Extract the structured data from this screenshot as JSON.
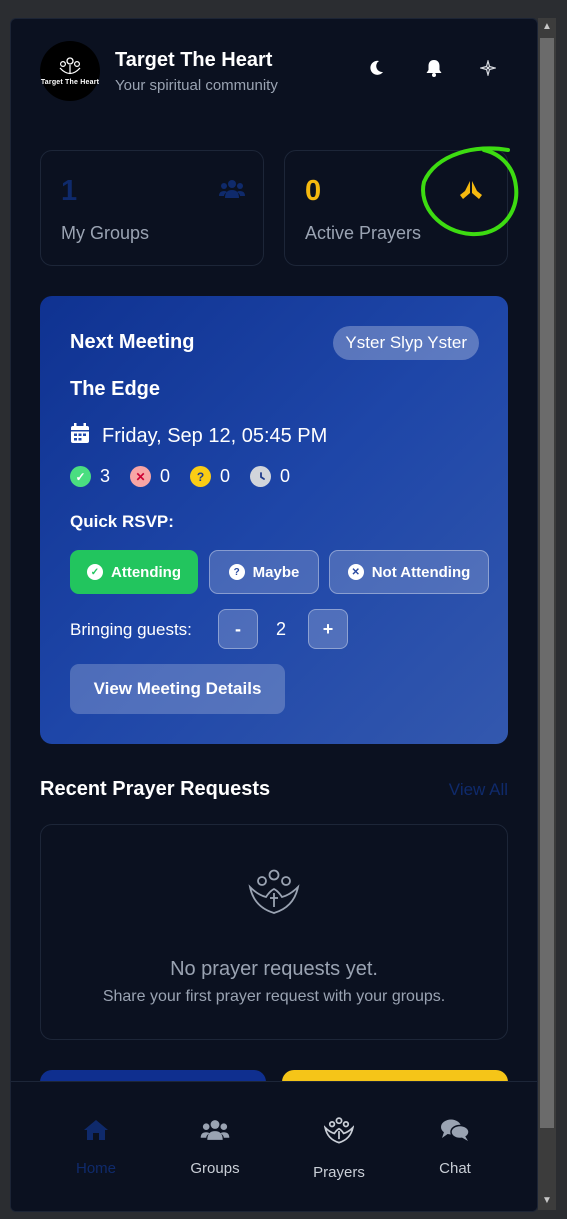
{
  "header": {
    "logo_text": "Target The Heart",
    "title": "Target The Heart",
    "subtitle": "Your spiritual community",
    "icons": [
      "moon-icon",
      "bell-icon",
      "sparkle-icon"
    ]
  },
  "stats": [
    {
      "value": "1",
      "label": "My Groups",
      "icon": "users-icon",
      "color": "#0f2a6b"
    },
    {
      "value": "0",
      "label": "Active Prayers",
      "icon": "praying-hands-icon",
      "color": "#f5b90f"
    }
  ],
  "meeting": {
    "heading": "Next Meeting",
    "badge": "Yster Slyp Yster",
    "name": "The Edge",
    "date": "Friday, Sep 12, 05:45 PM",
    "counts": [
      {
        "icon": "check-icon",
        "value": "3",
        "color": "#4ade80"
      },
      {
        "icon": "cross-icon",
        "value": "0",
        "color": "#f8a5a5"
      },
      {
        "icon": "question-icon",
        "value": "0",
        "color": "#facc15"
      },
      {
        "icon": "clock-icon",
        "value": "0",
        "color": "#d1d5db"
      }
    ],
    "quick_rsvp_label": "Quick RSVP:",
    "rsvp": {
      "attending": "Attending",
      "maybe": "Maybe",
      "not_attending": "Not Attending"
    },
    "guests_label": "Bringing guests:",
    "guests_minus": "-",
    "guests_value": "2",
    "guests_plus": "+",
    "details_button": "View Meeting Details"
  },
  "recent": {
    "title": "Recent Prayer Requests",
    "view_all": "View All",
    "empty_title": "No prayer requests yet.",
    "empty_sub": "Share your first prayer request with your groups."
  },
  "nav": [
    {
      "label": "Home",
      "icon": "home-icon",
      "active": true
    },
    {
      "label": "Groups",
      "icon": "users-icon",
      "active": false
    },
    {
      "label": "Prayers",
      "icon": "prayer-icon",
      "active": false
    },
    {
      "label": "Chat",
      "icon": "chat-icon",
      "active": false
    }
  ],
  "colors": {
    "background": "#0b1120",
    "accent_blue": "#0f2a6b",
    "accent_yellow": "#f5b90f",
    "attending_green": "#22c55e",
    "annotation_green": "#3ddc11"
  }
}
